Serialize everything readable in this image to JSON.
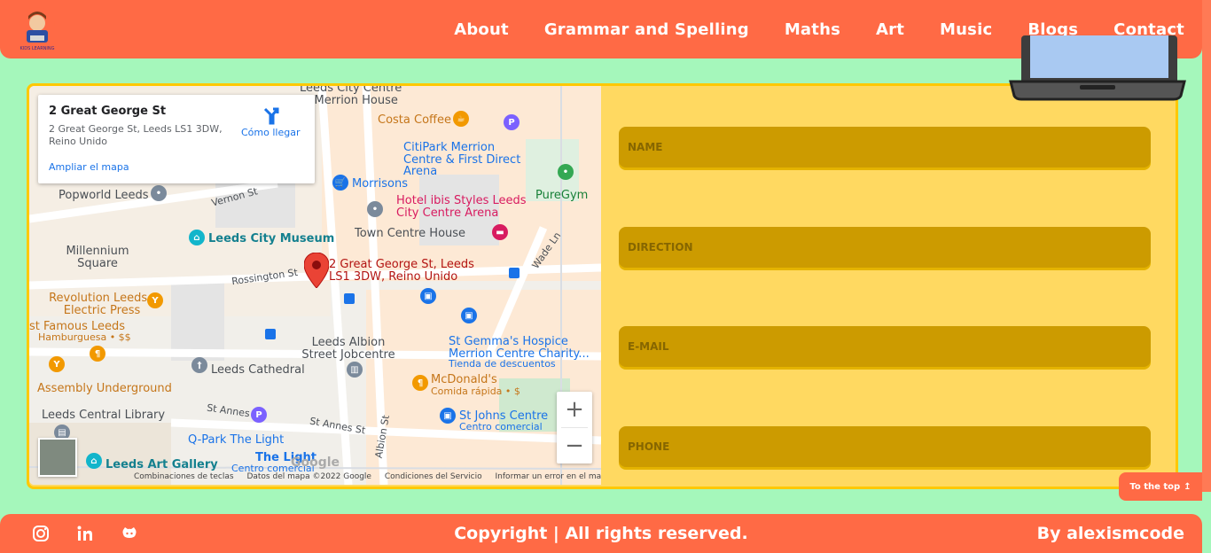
{
  "header": {
    "logo_text": "KIDS LEARNING",
    "nav": [
      {
        "label": "About"
      },
      {
        "label": "Grammar and Spelling"
      },
      {
        "label": "Maths"
      },
      {
        "label": "Art"
      },
      {
        "label": "Music"
      },
      {
        "label": "Blogs"
      },
      {
        "label": "Contact"
      }
    ]
  },
  "map": {
    "infocard": {
      "title": "2 Great George St",
      "address": "2 Great George St, Leeds LS1 3DW, Reino Unido",
      "directions": "Cómo llegar",
      "enlarge": "Ampliar el mapa"
    },
    "pin_label": "2 Great George St, Leeds LS1 3DW, Reino Unido",
    "labels": {
      "leeds_city_centre": "Leeds City Centre",
      "merrion_house": "b, Merrion House",
      "costa": "Costa Coffee",
      "citipark": "CitiPark Merrion Centre & First Direct Arena",
      "popworld": "Popworld Leeds",
      "vernon": "Vernon St",
      "morrisons": "Morrisons",
      "ibis": "Hotel ibis Styles Leeds City Centre Arena",
      "puregym": "PureGym",
      "museum": "Leeds City Museum",
      "town_centre": "Town Centre House",
      "millennium": "Millennium Square",
      "wade": "Wade Ln",
      "rossington": "Rossington St",
      "revolution": "Revolution Leeds - Electric Press",
      "famous": "st Famous Leeds",
      "famous_sub": "Hamburguesa • $$",
      "albion_job": "Leeds Albion Street Jobcentre",
      "stgemma": "St Gemma's Hospice Merrion Centre Charity...",
      "stgemma_sub": "Tienda de descuentos",
      "cathedral": "Leeds Cathedral",
      "assembly": "Assembly Underground",
      "mcdonalds": "McDonald's",
      "mcdonalds_sub": "Comida rápida • $",
      "library": "Leeds Central Library",
      "stannes1": "St Annes St",
      "stannes2": "St Annes St",
      "stjohns": "St Johns Centre",
      "stjohns_sub": "Centro comercial",
      "qpark": "Q-Park The Light",
      "albion_st": "Albion St",
      "artgallery": "Leeds Art Gallery",
      "thelight": "The Light",
      "thelight_sub": "Centro comercial"
    },
    "google": "Google",
    "attribution": [
      "Combinaciones de teclas",
      "Datos del mapa ©2022 Google",
      "Condiciones del Servicio",
      "Informar un error en el mapa"
    ],
    "zoom_in": "+",
    "zoom_out": "−"
  },
  "form": {
    "name_placeholder": "NAME",
    "direction_placeholder": "DIRECTION",
    "email_placeholder": "E-MAIL",
    "phone_placeholder": "PHONE"
  },
  "to_top": "To the top",
  "footer": {
    "copyright": "Copyright | All rights reserved.",
    "author": "By alexismcode",
    "social_icons": [
      "instagram-icon",
      "linkedin-icon",
      "github-icon"
    ]
  },
  "colors": {
    "header": "#ff6a45",
    "background": "#a5f7bb",
    "card": "#ffd961",
    "field": "#cc9b00"
  }
}
